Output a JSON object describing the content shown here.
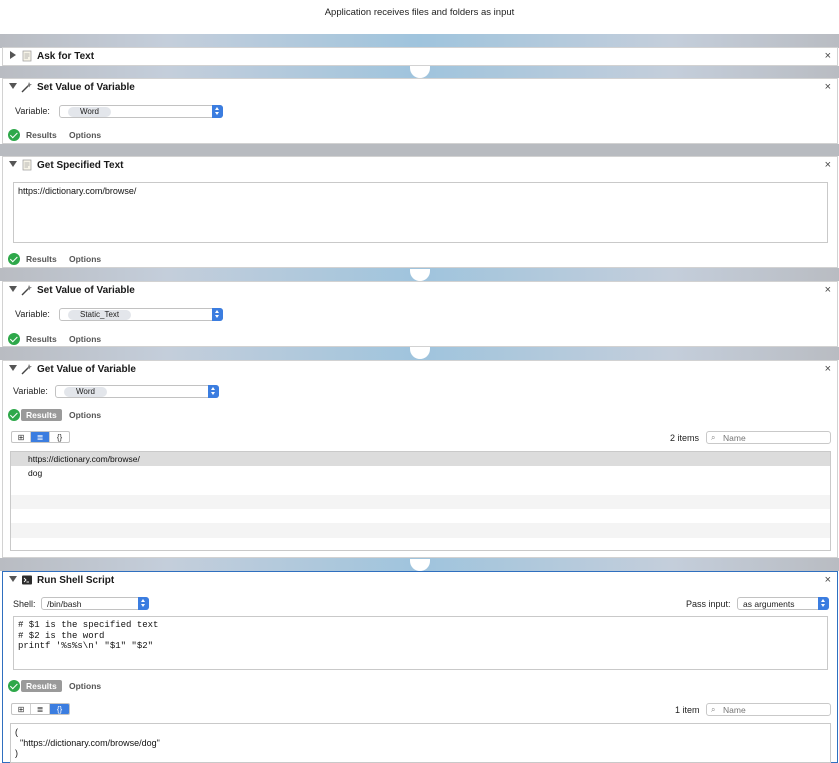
{
  "workflow": {
    "header_text": "Application receives files and folders as input"
  },
  "common": {
    "results_label": "Results",
    "options_label": "Options",
    "close_glyph": "×",
    "variable_label": "Variable:"
  },
  "actions": {
    "ask_for_text": {
      "title": "Ask for Text"
    },
    "set_value_1": {
      "title": "Set Value of Variable",
      "variable": "Word"
    },
    "get_specified_text": {
      "title": "Get Specified Text",
      "text": "https://dictionary.com/browse/"
    },
    "set_value_2": {
      "title": "Set Value of Variable",
      "variable": "Static_Text"
    },
    "get_value": {
      "title": "Get Value of Variable",
      "variable": "Word",
      "item_count": "2 items",
      "search_placeholder": "Name",
      "items": [
        "https://dictionary.com/browse/",
        "dog"
      ]
    },
    "run_shell_script": {
      "title": "Run Shell Script",
      "shell_label": "Shell:",
      "shell_value": "/bin/bash",
      "pass_input_label": "Pass input:",
      "pass_input_value": "as arguments",
      "script": "# $1 is the specified text\n# $2 is the word\nprintf '%s%s\\n' \"$1\" \"$2\"",
      "item_count": "1 item",
      "search_placeholder": "Name",
      "output": "(\n  \"https://dictionary.com/browse/dog\"\n)"
    }
  },
  "icons": {
    "grid_view": "⊞",
    "list_view": "≣",
    "code_view": "{}",
    "search": "⌕"
  }
}
